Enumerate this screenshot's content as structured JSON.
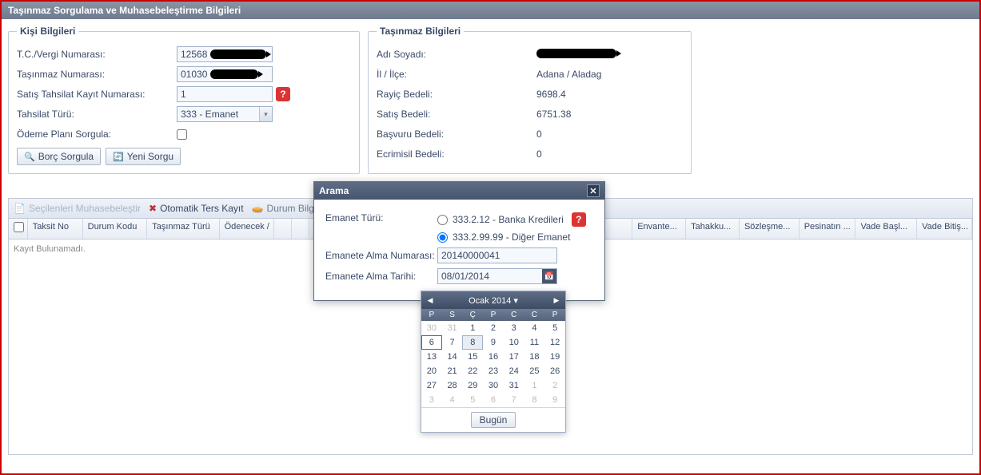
{
  "header": {
    "title": "Taşınmaz Sorgulama ve Muhasebeleştirme Bilgileri"
  },
  "kisi": {
    "legend": "Kişi Bilgileri",
    "l_tc": "T.C./Vergi Numarası:",
    "v_tc": "12568",
    "l_tasno": "Taşınmaz Numarası:",
    "v_tasno": "01030",
    "l_satis": "Satış Tahsilat Kayıt Numarası:",
    "v_satis": "1",
    "l_tahsilat": "Tahsilat Türü:",
    "v_tahsilat": "333 - Emanet",
    "l_odeme": "Ödeme Planı Sorgula:",
    "btn_borc": "Borç Sorgula",
    "btn_yeni": "Yeni Sorgu"
  },
  "tasinmaz": {
    "legend": "Taşınmaz Bilgileri",
    "l_ad": "Adı Soyadı:",
    "l_il": "İl / İlçe:",
    "v_il": "Adana / Aladag",
    "l_rayic": "Rayiç Bedeli:",
    "v_rayic": "9698.4",
    "l_satis": "Satış Bedeli:",
    "v_satis": "6751.38",
    "l_basvuru": "Başvuru Bedeli:",
    "v_basvuru": "0",
    "l_ecrimisil": "Ecrimisil Bedeli:",
    "v_ecrimisil": "0"
  },
  "toolbar": {
    "secilen": "Seçilenleri Muhasebeleştir",
    "otomatik": "Otomatik Ters Kayıt",
    "durum": "Durum Bilgisi D"
  },
  "grid": {
    "cols": [
      "",
      "Taksit No",
      "Durum Kodu",
      "Taşınmaz Türü",
      "Ödenecek /",
      "",
      "",
      "",
      "",
      "Envante...",
      "Tahakku...",
      "Sözleşme...",
      "Pesinatın ...",
      "Vade Başl...",
      "Vade Bitiş..."
    ],
    "widths": [
      24,
      70,
      82,
      92,
      70,
      22,
      22,
      22,
      390,
      68,
      68,
      76,
      72,
      78,
      70
    ],
    "empty": "Kayıt Bulunamadı."
  },
  "modal": {
    "title": "Arama",
    "l_emanet_turu": "Emanet Türü:",
    "r1": "333.2.12 - Banka Kredileri",
    "r2": "333.2.99.99 - Diğer Emanet",
    "l_numara": "Emanete Alma Numarası:",
    "v_numara": "20140000041",
    "l_tarih": "Emanete Alma Tarihi:",
    "v_tarih": "08/01/2014"
  },
  "calendar": {
    "month": "Ocak 2014",
    "dow": [
      "P",
      "S",
      "Ç",
      "P",
      "C",
      "C",
      "P"
    ],
    "days": [
      {
        "d": 30,
        "m": true
      },
      {
        "d": 31,
        "m": true
      },
      {
        "d": 1
      },
      {
        "d": 2
      },
      {
        "d": 3
      },
      {
        "d": 4
      },
      {
        "d": 5
      },
      {
        "d": 6,
        "today": true
      },
      {
        "d": 7
      },
      {
        "d": 8,
        "sel": true
      },
      {
        "d": 9
      },
      {
        "d": 10
      },
      {
        "d": 11
      },
      {
        "d": 12
      },
      {
        "d": 13
      },
      {
        "d": 14
      },
      {
        "d": 15
      },
      {
        "d": 16
      },
      {
        "d": 17
      },
      {
        "d": 18
      },
      {
        "d": 19
      },
      {
        "d": 20
      },
      {
        "d": 21
      },
      {
        "d": 22
      },
      {
        "d": 23
      },
      {
        "d": 24
      },
      {
        "d": 25
      },
      {
        "d": 26
      },
      {
        "d": 27
      },
      {
        "d": 28
      },
      {
        "d": 29
      },
      {
        "d": 30
      },
      {
        "d": 31
      },
      {
        "d": 1,
        "m": true
      },
      {
        "d": 2,
        "m": true
      },
      {
        "d": 3,
        "m": true
      },
      {
        "d": 4,
        "m": true
      },
      {
        "d": 5,
        "m": true
      },
      {
        "d": 6,
        "m": true
      },
      {
        "d": 7,
        "m": true
      },
      {
        "d": 8,
        "m": true
      },
      {
        "d": 9,
        "m": true
      }
    ],
    "today_btn": "Bugün"
  }
}
